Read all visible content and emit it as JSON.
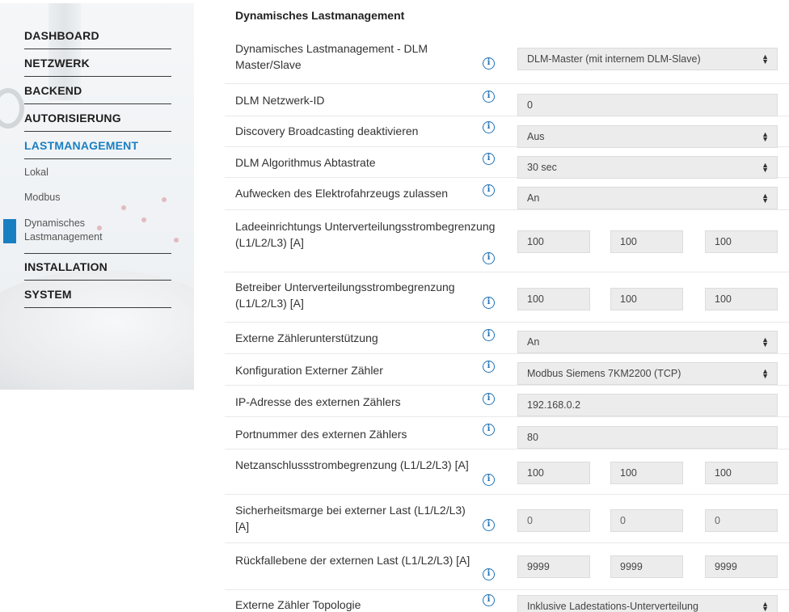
{
  "sidebar": {
    "items": [
      {
        "label": "DASHBOARD"
      },
      {
        "label": "NETZWERK"
      },
      {
        "label": "BACKEND"
      },
      {
        "label": "AUTORISIERUNG"
      },
      {
        "label": "LASTMANAGEMENT"
      },
      {
        "label": "INSTALLATION"
      },
      {
        "label": "SYSTEM"
      }
    ],
    "subitems": [
      {
        "label": "Lokal"
      },
      {
        "label": "Modbus"
      },
      {
        "label": "Dynamisches Lastmanagement"
      }
    ]
  },
  "section": {
    "title": "Dynamisches Lastmanagement"
  },
  "info_icon": "info-icon",
  "accent_color": "#1a7fc1",
  "rows": [
    {
      "label": "Dynamisches Lastmanagement - DLM Master/Slave",
      "type": "select",
      "value": "DLM-Master (mit internem DLM-Slave)"
    },
    {
      "label": "DLM Netzwerk-ID",
      "type": "text",
      "value": "0"
    },
    {
      "label": "Discovery Broadcasting deaktivieren",
      "type": "select",
      "value": "Aus"
    },
    {
      "label": "DLM Algorithmus Abtastrate",
      "type": "select",
      "value": "30 sec"
    },
    {
      "label": "Aufwecken des Elektrofahrzeugs zulassen",
      "type": "select",
      "value": "An"
    },
    {
      "label": "Ladeeinrichtungs Unterverteilungsstrombegrenzung (L1/L2/L3) [A]",
      "type": "triple",
      "values": [
        "100",
        "100",
        "100"
      ]
    },
    {
      "label": "Betreiber Unterverteilungsstrombegrenzung (L1/L2/L3) [A]",
      "type": "triple",
      "values": [
        "100",
        "100",
        "100"
      ]
    },
    {
      "label": "Externe Zählerunterstützung",
      "type": "select",
      "value": "An"
    },
    {
      "label": "Konfiguration Externer Zähler",
      "type": "select",
      "value": "Modbus Siemens 7KM2200 (TCP)"
    },
    {
      "label": "IP-Adresse des externen Zählers",
      "type": "text",
      "value": "192.168.0.2"
    },
    {
      "label": "Portnummer des externen Zählers",
      "type": "text",
      "value": "80"
    },
    {
      "label": "Netzanschlussstrombegrenzung (L1/L2/L3) [A]",
      "type": "triple",
      "values": [
        "100",
        "100",
        "100"
      ]
    },
    {
      "label": "Sicherheitsmarge bei externer Last (L1/L2/L3) [A]",
      "type": "triple",
      "values": [
        "0",
        "0",
        "0"
      ]
    },
    {
      "label": "Rückfallebene der externen Last (L1/L2/L3) [A]",
      "type": "triple",
      "values": [
        "9999",
        "9999",
        "9999"
      ]
    },
    {
      "label": "Externe Zähler Topologie",
      "type": "select",
      "value": "Inklusive Ladestations-Unterverteilung"
    }
  ]
}
